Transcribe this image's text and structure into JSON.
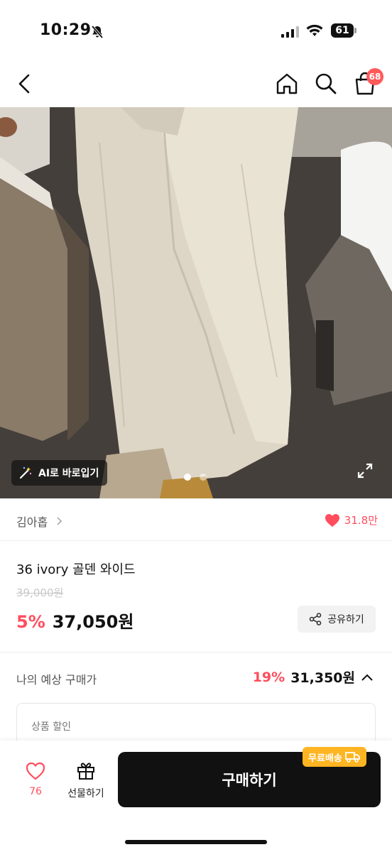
{
  "status_bar": {
    "time": "10:29",
    "battery": "61"
  },
  "nav": {
    "cart_count": "68"
  },
  "gallery": {
    "ai_try_on_label": "AI로 바로입기",
    "current_index": 1,
    "total": 2
  },
  "brand": {
    "name": "김아홉",
    "likes": "31.8만"
  },
  "product": {
    "title": "36 ivory 골덴 와이드",
    "original_price": "39,000원",
    "discount": "5%",
    "price": "37,050원",
    "share_label": "공유하기"
  },
  "estimate": {
    "label": "나의 예상 구매가",
    "discount": "19%",
    "price": "31,350원"
  },
  "discount_card": {
    "label": "상품 할인"
  },
  "bottom": {
    "heart_count": "76",
    "gift_label": "선물하기",
    "buy_label": "구매하기",
    "shipping_badge": "무료배송"
  },
  "colors": {
    "accent": "#ff4d5e",
    "shipping": "#ffb521",
    "buy_button": "#111111"
  }
}
